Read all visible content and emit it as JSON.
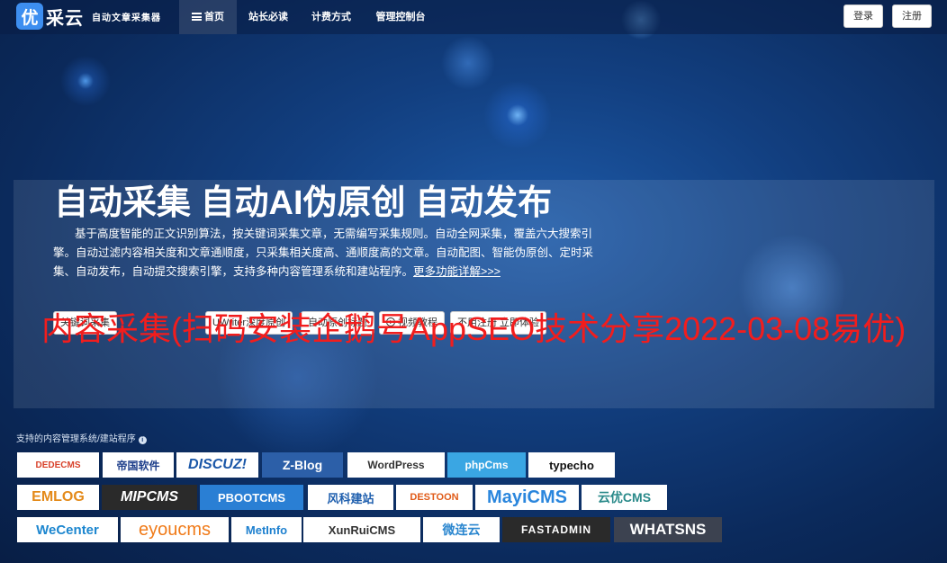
{
  "nav": {
    "logo_badge": "优",
    "logo_text": "采云",
    "logo_slogan": "自动文章采集器",
    "items": [
      {
        "label": "首页",
        "active": true
      },
      {
        "label": "站长必读"
      },
      {
        "label": "计费方式"
      },
      {
        "label": "管理控制台"
      }
    ],
    "login": "登录",
    "register": "注册"
  },
  "hero": {
    "title": "自动采集 自动AI伪原创 自动发布",
    "desc": "基于高度智能的正文识别算法，按关键词采集文章，无需编写采集规则。自动全网采集，覆盖六大搜索引擎。自动过滤内容相关度和文章通顺度，只采集相关度高、通顺度高的文章。自动配图、智能伪原创、定时采集、自动发布，自动提交搜索引擎，支持多种内容管理系统和建站程序。",
    "more": "更多功能详解>>>"
  },
  "buttons": {
    "b1": "关键词采集",
    "b2": "UWriter深度原创",
    "b3": "自动原创标题",
    "b4": "视频教程",
    "b5": "不用注册 立即体验"
  },
  "overlay": "内容采集(扫码安装企鹅号AppSEO技术分享2022-03-08易优)",
  "cms": {
    "label": "支持的内容管理系统/建站程序",
    "info_icon": "i",
    "row1": [
      "DEDECMS",
      "帝国软件",
      "DISCUZ!",
      "Z-Blog",
      "WordPress",
      "phpCms",
      "typecho"
    ],
    "row2": [
      "EMLOG",
      "MIPCMS",
      "PBOOTCMS",
      "风科建站",
      "DESTOON",
      "MayiCMS",
      "云优CMS"
    ],
    "row3": [
      "WeCenter",
      "eyoucms",
      "MetInfo",
      "XunRuiCMS",
      "微连云",
      "FASTADMIN",
      "WHATSNS"
    ]
  },
  "colors": {
    "overlay_text": "#f21d1d",
    "accent": "#3d8ef0"
  }
}
